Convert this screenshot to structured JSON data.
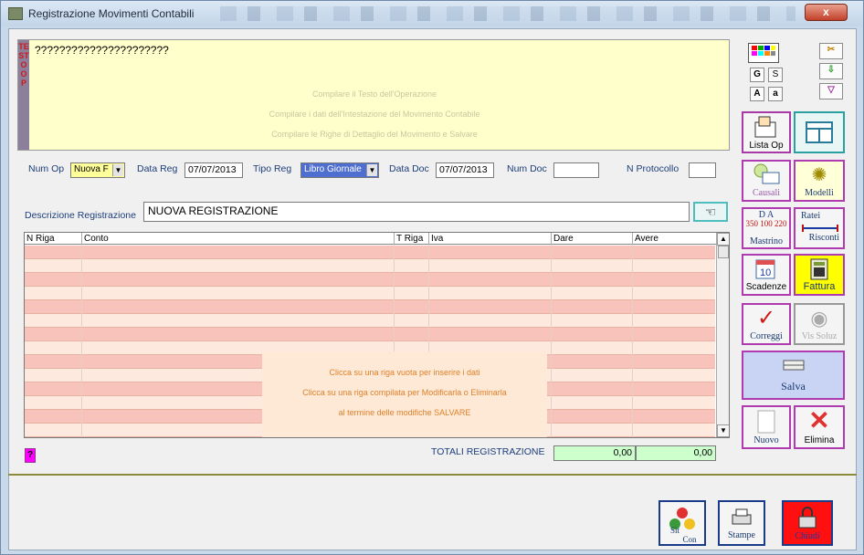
{
  "window": {
    "title": "Registrazione Movimenti Contabili",
    "close_label": "x"
  },
  "testo": {
    "strip_letters": "TESTO OP",
    "text": "??????????????????????",
    "hints": [
      "Compilare il Testo dell'Operazione",
      "Compilare i dati dell'Intestazione del Movimento Contabile",
      "Compilare le Righe di Dettaglio del Movimento e Salvare"
    ]
  },
  "header": {
    "num_op_label": "Num Op",
    "num_op_value": "Nuova F",
    "data_reg_label": "Data Reg",
    "data_reg_value": "07/07/2013",
    "tipo_reg_label": "Tipo Reg",
    "tipo_reg_value": "Libro Giornale",
    "data_doc_label": "Data Doc",
    "data_doc_value": "07/07/2013",
    "num_doc_label": "Num Doc",
    "num_doc_value": "",
    "n_protocollo_label": "N Protocollo",
    "n_protocollo_value": ""
  },
  "descrizione": {
    "label": "Descrizione Registrazione",
    "value": "NUOVA REGISTRAZIONE"
  },
  "grid": {
    "columns": [
      "N Riga",
      "Conto",
      "T Riga",
      "Iva",
      "Dare",
      "Avere"
    ],
    "overlay": [
      "Clicca su una riga vuota per inserire i dati",
      "Clicca su una riga compilata per Modificarla o Eliminarla",
      "al termine delle modifiche SALVARE"
    ]
  },
  "totals": {
    "label": "TOTALI REGISTRAZIONE",
    "dare": "0,00",
    "avere": "0,00"
  },
  "help_button": "?",
  "side": {
    "g": "G",
    "s": "S",
    "a_upper": "A",
    "a_lower": "a",
    "lista_op": "Lista Op",
    "causali": "Causali",
    "modelli": "Modelli",
    "mastrino_top": "D   A",
    "mastrino_nums": "350 100 220",
    "mastrino": "Mastrino",
    "ratei": "Ratei",
    "risconti": "Risconti",
    "scadenze": "Scadenze",
    "fattura": "Fattura",
    "correggi": "Correggi",
    "vis_soluz": "Vis Soluz",
    "salva": "Salva",
    "nuovo": "Nuovo",
    "elimina": "Elimina"
  },
  "bottom": {
    "sit_con_a": "Sit",
    "sit_con_b": "Con",
    "stampe": "Stampe",
    "chiudi": "Chiudi"
  }
}
